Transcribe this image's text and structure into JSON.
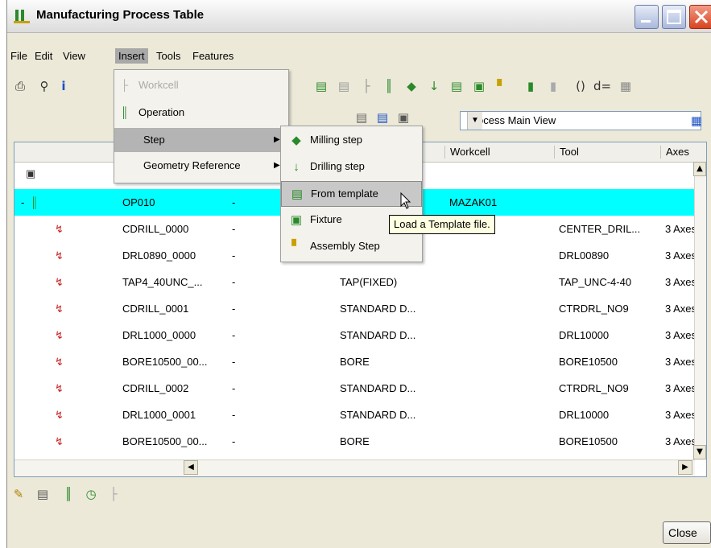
{
  "window": {
    "title": "Manufacturing Process Table"
  },
  "menubar": {
    "items": [
      "File",
      "Edit",
      "View",
      "Insert",
      "Tools",
      "Features"
    ]
  },
  "insert_menu": {
    "items": [
      {
        "label": "Workcell",
        "disabled": true
      },
      {
        "label": "Operation"
      },
      {
        "label": "Step",
        "submenu": true
      },
      {
        "label": "Geometry Reference",
        "submenu": true
      }
    ]
  },
  "step_submenu": {
    "items": [
      "Milling step",
      "Drilling step",
      "From template",
      "Fixture",
      "Assembly Step"
    ]
  },
  "tooltip": "Load a Template file.",
  "view_select": {
    "value": "Process Main View"
  },
  "table": {
    "headers": [
      "Workcell",
      "Tool",
      "Axes"
    ],
    "rows": [
      {
        "name": "",
        "dash": "",
        "type": "",
        "workcell": "",
        "tool": "",
        "axes": ""
      },
      {
        "name": "OP010",
        "dash": "-",
        "type": "",
        "workcell": "MAZAK01",
        "tool": "",
        "axes": ""
      },
      {
        "name": "CDRILL_0000",
        "dash": "-",
        "type": "",
        "workcell": "",
        "tool": "CENTER_DRIL...",
        "axes": "3 Axes"
      },
      {
        "name": "DRL0890_0000",
        "dash": "-",
        "type": "",
        "workcell": "",
        "tool": "DRL00890",
        "axes": "3 Axes"
      },
      {
        "name": "TAP4_40UNC_...",
        "dash": "-",
        "type": "TAP(FIXED)",
        "workcell": "",
        "tool": "TAP_UNC-4-40",
        "axes": "3 Axes"
      },
      {
        "name": "CDRILL_0001",
        "dash": "-",
        "type": "STANDARD D...",
        "workcell": "",
        "tool": "CTRDRL_NO9",
        "axes": "3 Axes"
      },
      {
        "name": "DRL1000_0000",
        "dash": "-",
        "type": "STANDARD D...",
        "workcell": "",
        "tool": "DRL10000",
        "axes": "3 Axes"
      },
      {
        "name": "BORE10500_00...",
        "dash": "-",
        "type": "BORE",
        "workcell": "",
        "tool": "BORE10500",
        "axes": "3 Axes"
      },
      {
        "name": "CDRILL_0002",
        "dash": "-",
        "type": "STANDARD D...",
        "workcell": "",
        "tool": "CTRDRL_NO9",
        "axes": "3 Axes"
      },
      {
        "name": "DRL1000_0001",
        "dash": "-",
        "type": "STANDARD D...",
        "workcell": "",
        "tool": "DRL10000",
        "axes": "3 Axes"
      },
      {
        "name": "BORE10500_00...",
        "dash": "-",
        "type": "BORE",
        "workcell": "",
        "tool": "BORE10500",
        "axes": "3 Axes"
      }
    ]
  },
  "footer": {
    "close_label": "Close"
  },
  "colors": {
    "selected_row": "#00ffff",
    "menu_highlight": "#b4b4b4"
  }
}
